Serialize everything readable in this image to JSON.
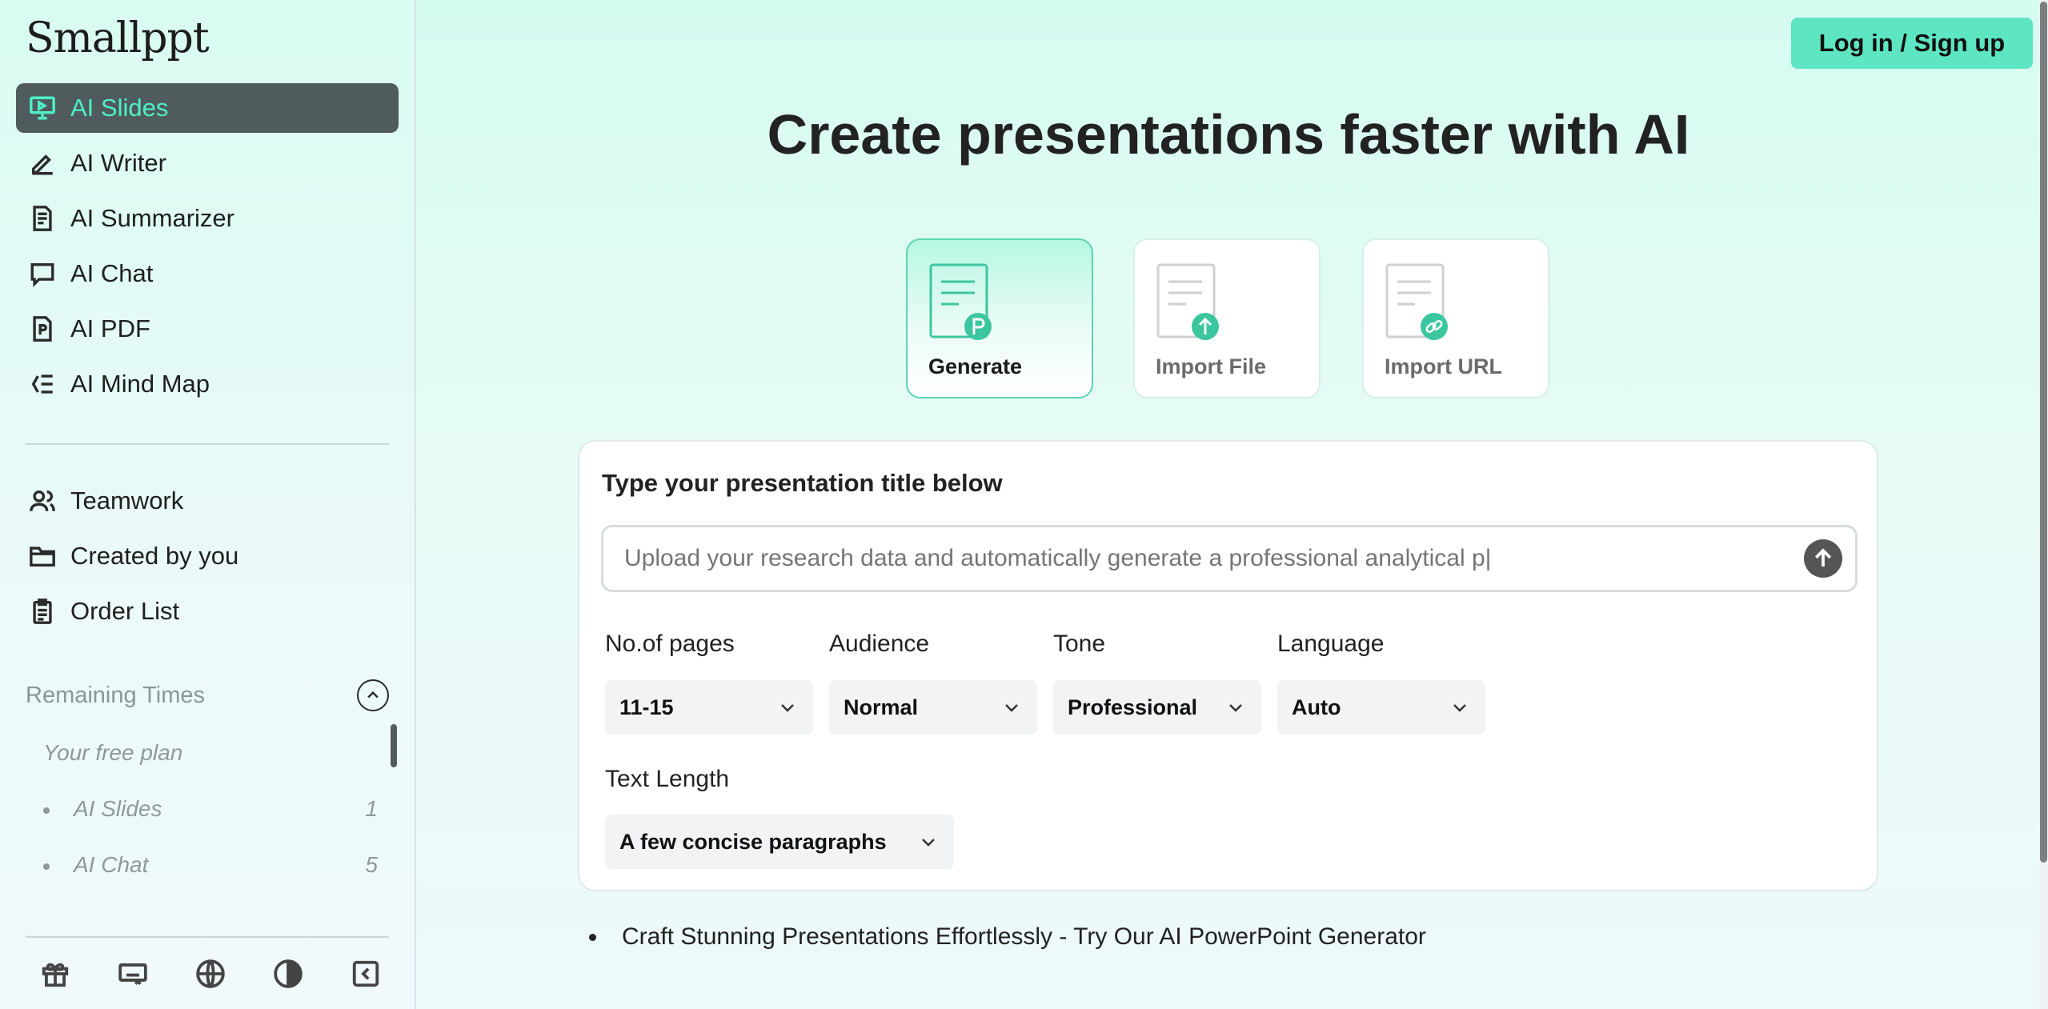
{
  "brand": {
    "name": "Smallppt"
  },
  "nav": {
    "primary": [
      {
        "label": "AI Slides",
        "icon": "presentation-icon",
        "active": true
      },
      {
        "label": "AI Writer",
        "icon": "pen-icon"
      },
      {
        "label": "AI Summarizer",
        "icon": "document-icon"
      },
      {
        "label": "AI Chat",
        "icon": "chat-icon"
      },
      {
        "label": "AI PDF",
        "icon": "pdf-icon"
      },
      {
        "label": "AI Mind Map",
        "icon": "mindmap-icon"
      }
    ],
    "secondary": [
      {
        "label": "Teamwork",
        "icon": "users-icon"
      },
      {
        "label": "Created by you",
        "icon": "folder-icon"
      },
      {
        "label": "Order List",
        "icon": "clipboard-icon"
      }
    ]
  },
  "remaining": {
    "title": "Remaining Times",
    "plan": "Your free plan",
    "items": [
      {
        "label": "AI Slides",
        "count": "1"
      },
      {
        "label": "AI Chat",
        "count": "5"
      }
    ]
  },
  "footer_icons": [
    "gift-icon",
    "keyboard-icon",
    "globe-icon",
    "contrast-icon",
    "collapse-sidebar-icon"
  ],
  "header": {
    "login_label": "Log in / Sign up"
  },
  "main": {
    "title": "Create presentations faster with AI",
    "modes": [
      {
        "label": "Generate",
        "icon": "p-badge-icon",
        "active": true
      },
      {
        "label": "Import File",
        "icon": "upload-badge-icon"
      },
      {
        "label": "Import URL",
        "icon": "link-badge-icon"
      }
    ],
    "form": {
      "heading": "Type your presentation title below",
      "prompt_placeholder": "Upload your research data and automatically generate a professional analytical p|",
      "fields": [
        {
          "label": "No.of pages",
          "value": "11-15"
        },
        {
          "label": "Audience",
          "value": "Normal"
        },
        {
          "label": "Tone",
          "value": "Professional"
        },
        {
          "label": "Language",
          "value": "Auto"
        }
      ],
      "text_length": {
        "label": "Text Length",
        "value": "A few concise paragraphs"
      }
    },
    "bullet": "Craft Stunning Presentations Effortlessly - Try Our AI PowerPoint Generator"
  },
  "colors": {
    "accent": "#5ee6c3",
    "active_nav_bg": "#4f5b5c",
    "active_nav_text": "#4ff0c6"
  }
}
